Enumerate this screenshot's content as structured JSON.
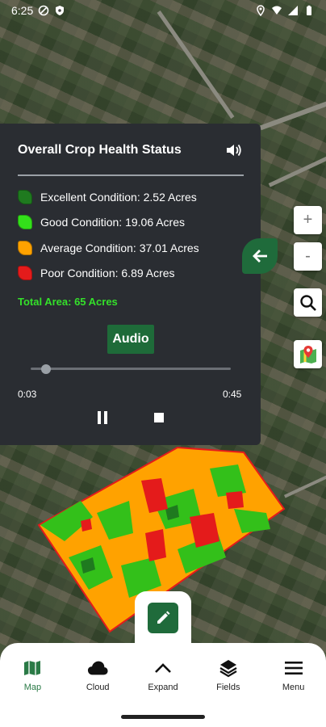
{
  "status_bar": {
    "time": "6:25"
  },
  "panel": {
    "title": "Overall Crop Health Status",
    "legend": [
      {
        "label": "Excellent Condition: 2.52 Acres",
        "color": "#1f7a1f"
      },
      {
        "label": "Good Condition: 19.06 Acres",
        "color": "#33e01a"
      },
      {
        "label": "Average Condition: 37.01 Acres",
        "color": "#ffa200"
      },
      {
        "label": "Poor Condition: 6.89 Acres",
        "color": "#e41b1b"
      }
    ],
    "total_area": "Total Area: 65 Acres",
    "audio_label": "Audio",
    "time_current": "0:03",
    "time_total": "0:45",
    "audio_progress_fraction": 0.067
  },
  "map_controls": {
    "zoom_in": "+",
    "zoom_out": "-"
  },
  "bottom_nav": {
    "items": [
      {
        "label": "Map",
        "active": true
      },
      {
        "label": "Cloud",
        "active": false
      },
      {
        "label": "Expand",
        "active": false
      },
      {
        "label": "Fields",
        "active": false
      },
      {
        "label": "Menu",
        "active": false
      }
    ]
  },
  "colors": {
    "accent": "#1f6b3b",
    "panel_bg": "#2a2d32",
    "total_text": "#34e02a"
  }
}
